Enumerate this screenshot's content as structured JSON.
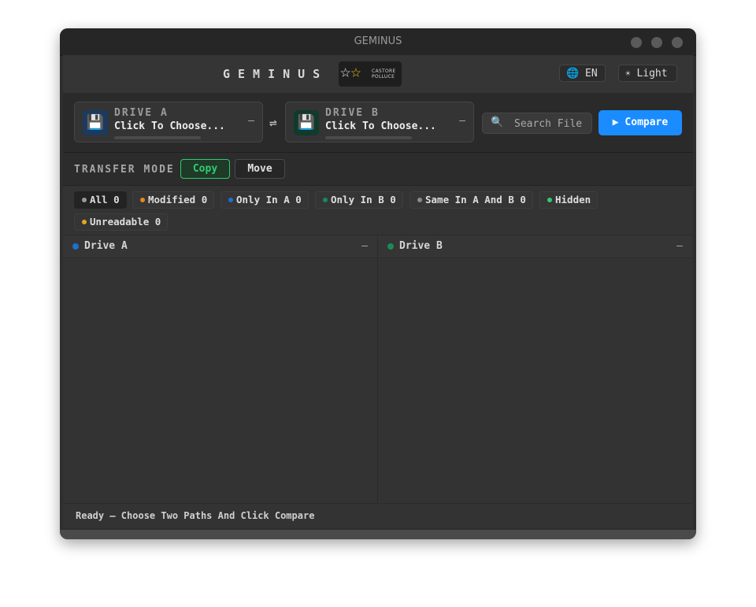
{
  "window": {
    "title": "GEMINUS"
  },
  "header": {
    "brand": "GEMINUS",
    "logo": {
      "line1": "CASTORE",
      "line2": "POLLUCE"
    },
    "language": {
      "icon": "globe-icon",
      "label": "EN"
    },
    "theme": {
      "icon": "sun-icon",
      "label": "Light"
    }
  },
  "drives": {
    "a": {
      "label": "DRIVE A",
      "value": "Click To Choose...",
      "icon": "floppy-disk-icon",
      "clear": "—",
      "accent": "#1565c0"
    },
    "b": {
      "label": "DRIVE B",
      "value": "Click To Choose...",
      "icon": "floppy-disk-icon",
      "clear": "—",
      "accent": "#0f6b4a"
    },
    "swap_icon": "swap-arrows-icon"
  },
  "search": {
    "placeholder": "Search File",
    "icon": "magnifier-icon"
  },
  "compare": {
    "label": "▶ Compare"
  },
  "transfer_mode": {
    "label": "TRANSFER MODE",
    "options": [
      {
        "label": "Copy",
        "selected": true
      },
      {
        "label": "Move",
        "selected": false
      }
    ]
  },
  "filters": [
    {
      "label": "All 0",
      "color": "#9a9a9a",
      "active": true
    },
    {
      "label": "Modified 0",
      "color": "#e08a1e",
      "active": false
    },
    {
      "label": "Only In A 0",
      "color": "#1e6fd0",
      "active": false
    },
    {
      "label": "Only In B 0",
      "color": "#1a8a5a",
      "active": false
    },
    {
      "label": "Same In A And B 0",
      "color": "#8a8a8a",
      "active": false
    },
    {
      "label": "Hidden",
      "color": "#2ecc71",
      "active": false
    },
    {
      "label": "Unreadable 0",
      "color": "#e0a81e",
      "active": false
    }
  ],
  "panels": {
    "a": {
      "title": "Drive A",
      "min": "—",
      "color": "#1e6fd0"
    },
    "b": {
      "title": "Drive B",
      "min": "—",
      "color": "#1a8a5a"
    }
  },
  "status": {
    "text": "Ready — Choose Two Paths And Click Compare"
  }
}
